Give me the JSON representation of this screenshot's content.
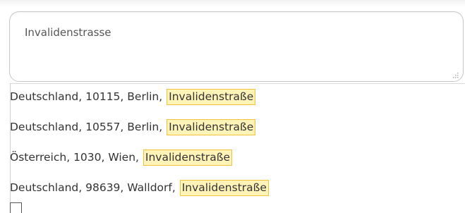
{
  "address_input": {
    "value": "Invalidenstrasse"
  },
  "suggestions": [
    {
      "prefix": "Deutschland, 10115, Berlin, ",
      "match": "Invalidenstraße"
    },
    {
      "prefix": "Deutschland, 10557, Berlin, ",
      "match": "Invalidenstraße"
    },
    {
      "prefix": "Österreich, 1030, Wien, ",
      "match": "Invalidenstraße"
    },
    {
      "prefix": "Deutschland, 98639, Walldorf, ",
      "match": "Invalidenstraße"
    }
  ],
  "colors": {
    "highlight_fill": "#fff3b8",
    "highlight_border": "#f2c23a",
    "input_border": "#c8c8c8",
    "text": "#333333"
  }
}
